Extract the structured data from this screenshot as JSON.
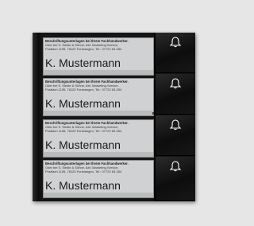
{
  "panel": {
    "nameplates": [
      {
        "header": "Beschriftungsunterlagen bei Ihrem Fachhandwerker.",
        "line1": "Oder bei S. Siedle & Söhne, Abt. Marketing-Service,",
        "line2": "Postfach 1155, 78120 Furtwangen, Tel.: 07723 63-354",
        "name": "K. Mustermann"
      },
      {
        "header": "Beschriftungsunterlagen bei Ihrem Fachhandwerker.",
        "line1": "Oder bei S. Siedle & Söhne, Abt. Marketing-Service,",
        "line2": "Postfach 1155, 78120 Furtwangen, Tel.: 07723 63-354",
        "name": "K. Mustermann"
      },
      {
        "header": "Beschriftungsunterlagen bei Ihrem Fachhandwerker.",
        "line1": "Oder bei S. Siedle & Söhne, Abt. Marketing-Service,",
        "line2": "Postfach 1155, 78120 Furtwangen, Tel.: 07723 63-354",
        "name": "K. Mustermann"
      },
      {
        "header": "Beschriftungsunterlagen bei Ihrem Fachhandwerker.",
        "line1": "Oder bei S. Siedle & Söhne, Abt. Marketing-Service,",
        "line2": "Postfach 1155, 78120 Furtwangen, Tel.: 07723 63-354",
        "name": "K. Mustermann"
      }
    ],
    "bell_buttons": [
      {
        "icon": "bell-icon"
      },
      {
        "icon": "bell-icon"
      },
      {
        "icon": "bell-icon"
      },
      {
        "icon": "bell-icon"
      }
    ],
    "colors": {
      "background": "#e6e6e6",
      "panel": "#151515",
      "nameplate": "#cfd1d2",
      "bell": "#ffffff"
    }
  }
}
